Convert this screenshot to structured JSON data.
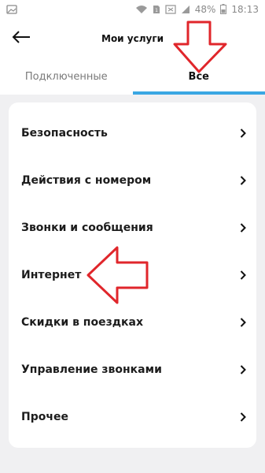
{
  "status_bar": {
    "battery_text": "48%",
    "time": "18:13"
  },
  "header": {
    "title": "Мои услуги",
    "back_icon": "arrow-left-icon"
  },
  "tabs": [
    {
      "label": "Подключенные",
      "active": false
    },
    {
      "label": "Все",
      "active": true
    }
  ],
  "services": [
    {
      "label": "Безопасность"
    },
    {
      "label": "Действия с номером"
    },
    {
      "label": "Звонки и сообщения"
    },
    {
      "label": "Интернет"
    },
    {
      "label": "Скидки в поездках"
    },
    {
      "label": "Управление звонками"
    },
    {
      "label": "Прочее"
    }
  ],
  "colors": {
    "accent_tab": "#3aa7e3",
    "annotation_red": "#e0262b",
    "background": "#f0f0f2"
  }
}
